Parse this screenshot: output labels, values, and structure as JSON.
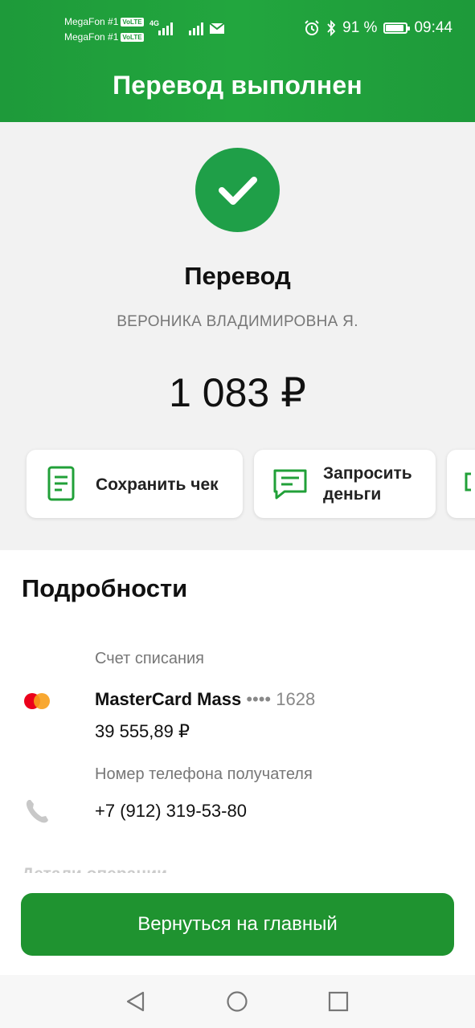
{
  "status_bar": {
    "carrier1": "MegaFon #1",
    "carrier2": "MegaFon #1",
    "volte": "VoLTE",
    "network": "4G",
    "battery_percent": "91 %",
    "battery_level": 0.91,
    "time": "09:44"
  },
  "header": {
    "title": "Перевод выполнен"
  },
  "summary": {
    "label": "Перевод",
    "recipient": "ВЕРОНИКА ВЛАДИМИРОВНА Я.",
    "amount": "1 083 ₽"
  },
  "actions": [
    {
      "label": "Сохранить чек",
      "icon": "receipt-icon"
    },
    {
      "label": "Запросить деньги",
      "label_line1": "Запросить",
      "label_line2": "деньги",
      "icon": "message-icon"
    }
  ],
  "details": {
    "title": "Подробности",
    "source_label": "Счет списания",
    "card_name": "MasterCard Mass",
    "card_number": "•••• 1628",
    "balance": "39 555,89 ₽",
    "phone_label": "Номер телефона получателя",
    "phone": "+7 (912) 319-53-80",
    "next_section_partial": "Детали операции"
  },
  "footer": {
    "home_button": "Вернуться на главный"
  },
  "colors": {
    "brand_green": "#21a038",
    "check_green": "#1f9f48",
    "button_green": "#1f9330"
  }
}
